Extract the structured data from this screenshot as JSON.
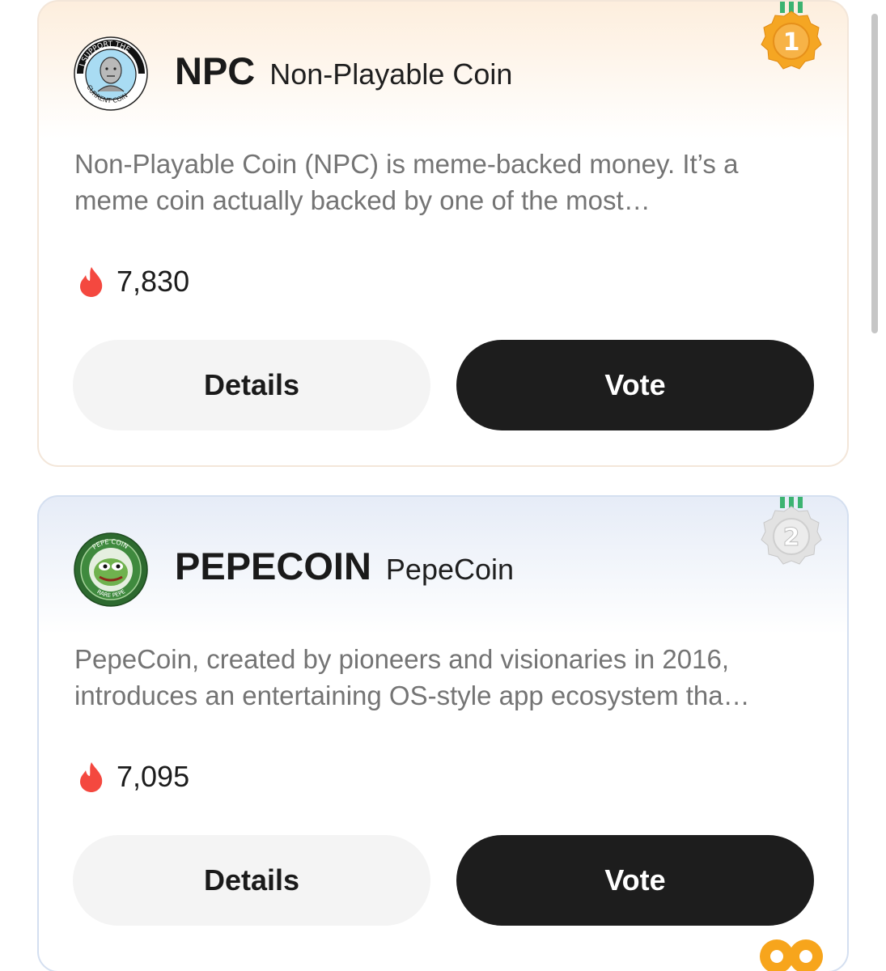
{
  "cards": [
    {
      "rank": "1",
      "symbol": "NPC",
      "name": "Non-Playable Coin",
      "description": "Non-Playable Coin (NPC) is meme-backed money. It’s a meme coin actually backed by one of the most…",
      "votes": "7,830",
      "details_label": "Details",
      "vote_label": "Vote",
      "logo_text_top": "I SUPPORT THE",
      "logo_text_bottom": "CURRENT COIN",
      "medal_color": "#f5a623"
    },
    {
      "rank": "2",
      "symbol": "PEPECOIN",
      "name": "PepeCoin",
      "description": "PepeCoin, created by pioneers and visionaries in 2016, introduces an entertaining OS-style app ecosystem tha…",
      "votes": "7,095",
      "details_label": "Details",
      "vote_label": "Vote",
      "logo_text_top": "PEPE COIN",
      "logo_text_bottom": "RARE PEPE",
      "medal_color": "#d9d9d9"
    }
  ],
  "colors": {
    "fire": "#f4483f",
    "vote_button": "#1d1d1d",
    "details_button": "#f4f4f4",
    "floating_icon": "#f7a51c"
  },
  "icons": {
    "votes": "fire-icon",
    "floating": "gift-loop-icon"
  }
}
